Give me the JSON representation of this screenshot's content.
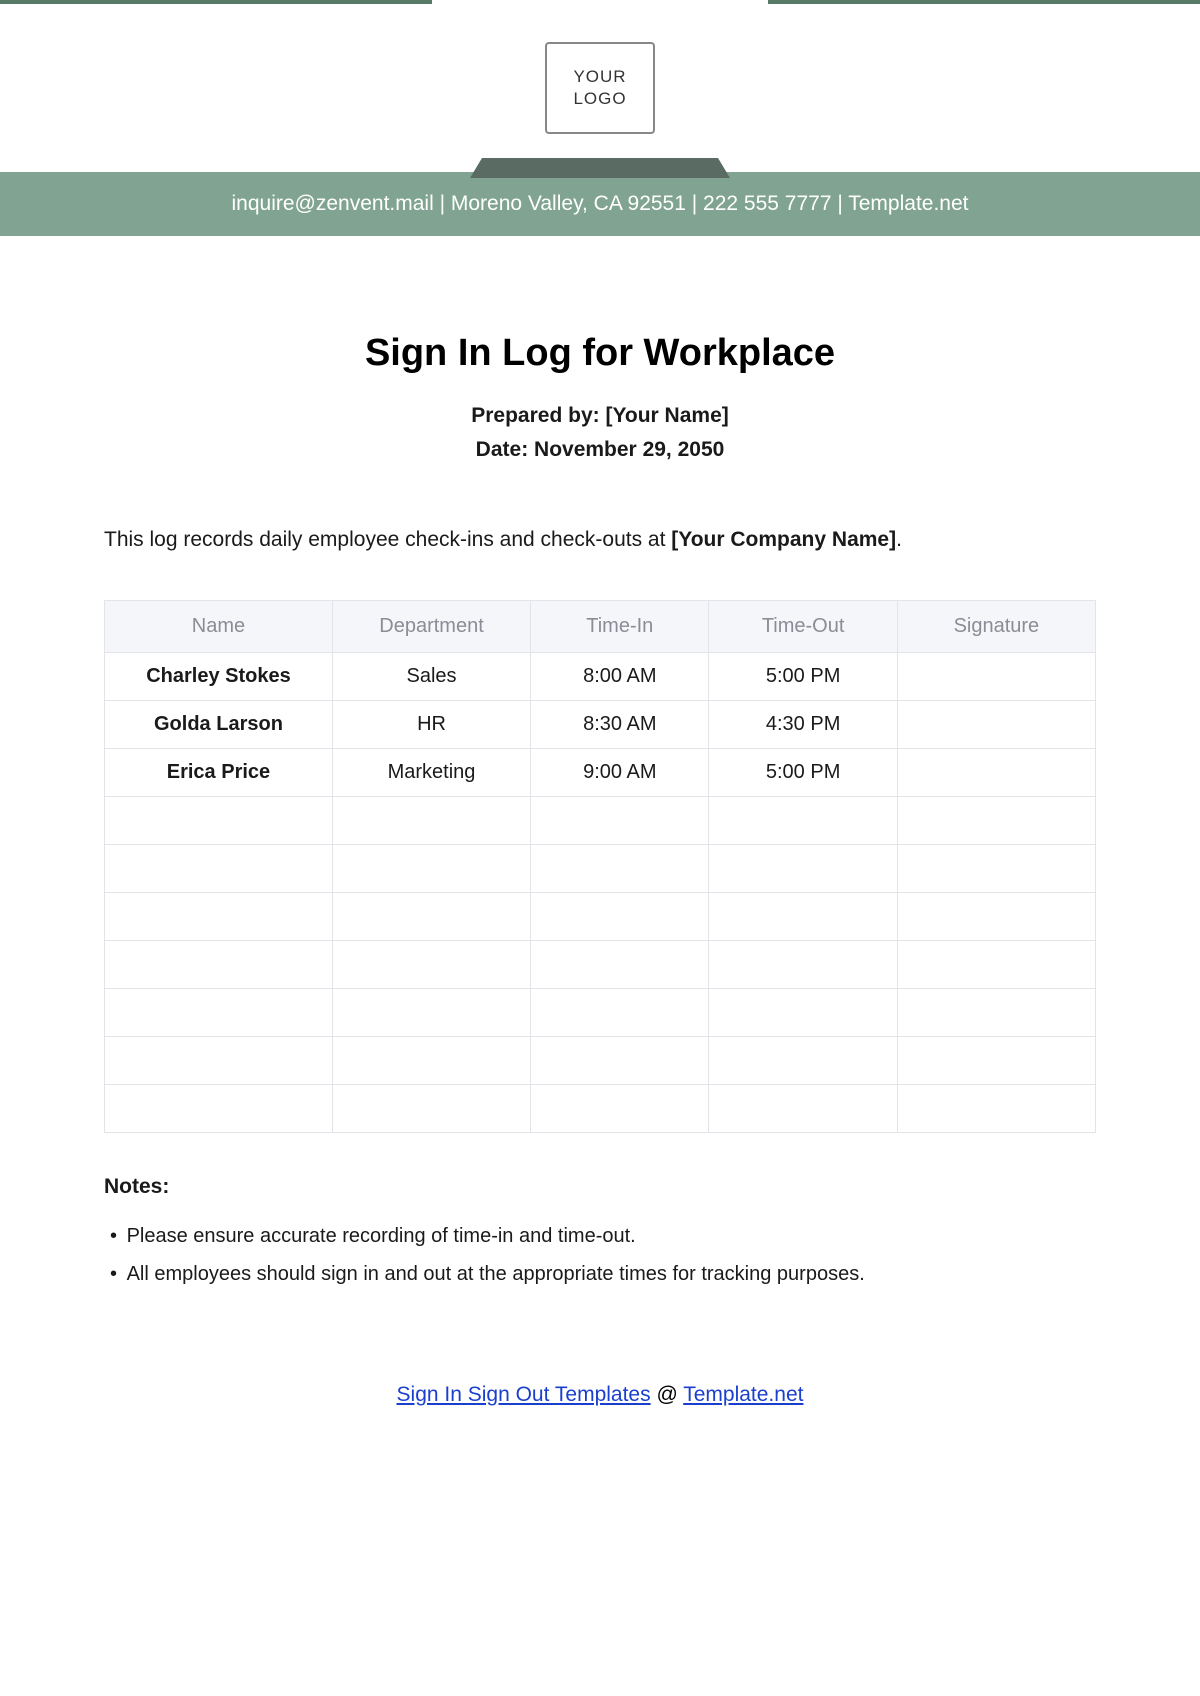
{
  "logo": "YOUR\nLOGO",
  "header_bar": "inquire@zenvent.mail | Moreno Valley, CA 92551 | 222 555 7777 | Template.net",
  "title": "Sign In Log for Workplace",
  "prepared_label": "Prepared by: ",
  "prepared_value": "[Your Name]",
  "date_label": "Date: ",
  "date_value": "November 29, 2050",
  "desc_pre": "This log records daily employee check-ins and check-outs at ",
  "desc_bold": "[Your Company Name]",
  "desc_post": ".",
  "columns": [
    "Name",
    "Department",
    "Time-In",
    "Time-Out",
    "Signature"
  ],
  "rows": [
    {
      "name": "Charley Stokes",
      "dept": "Sales",
      "in": "8:00 AM",
      "out": "5:00 PM",
      "sig": ""
    },
    {
      "name": "Golda Larson",
      "dept": "HR",
      "in": "8:30 AM",
      "out": "4:30 PM",
      "sig": ""
    },
    {
      "name": "Erica Price",
      "dept": "Marketing",
      "in": "9:00 AM",
      "out": "5:00 PM",
      "sig": ""
    },
    {
      "name": "",
      "dept": "",
      "in": "",
      "out": "",
      "sig": ""
    },
    {
      "name": "",
      "dept": "",
      "in": "",
      "out": "",
      "sig": ""
    },
    {
      "name": "",
      "dept": "",
      "in": "",
      "out": "",
      "sig": ""
    },
    {
      "name": "",
      "dept": "",
      "in": "",
      "out": "",
      "sig": ""
    },
    {
      "name": "",
      "dept": "",
      "in": "",
      "out": "",
      "sig": ""
    },
    {
      "name": "",
      "dept": "",
      "in": "",
      "out": "",
      "sig": ""
    },
    {
      "name": "",
      "dept": "",
      "in": "",
      "out": "",
      "sig": ""
    }
  ],
  "notes_title": "Notes:",
  "notes": [
    "Please ensure accurate recording of time-in and time-out.",
    "All employees should sign in and out at the appropriate times for tracking purposes."
  ],
  "footer": {
    "link1": "Sign In Sign Out Templates",
    "at": " @ ",
    "link2": "Template.net"
  }
}
